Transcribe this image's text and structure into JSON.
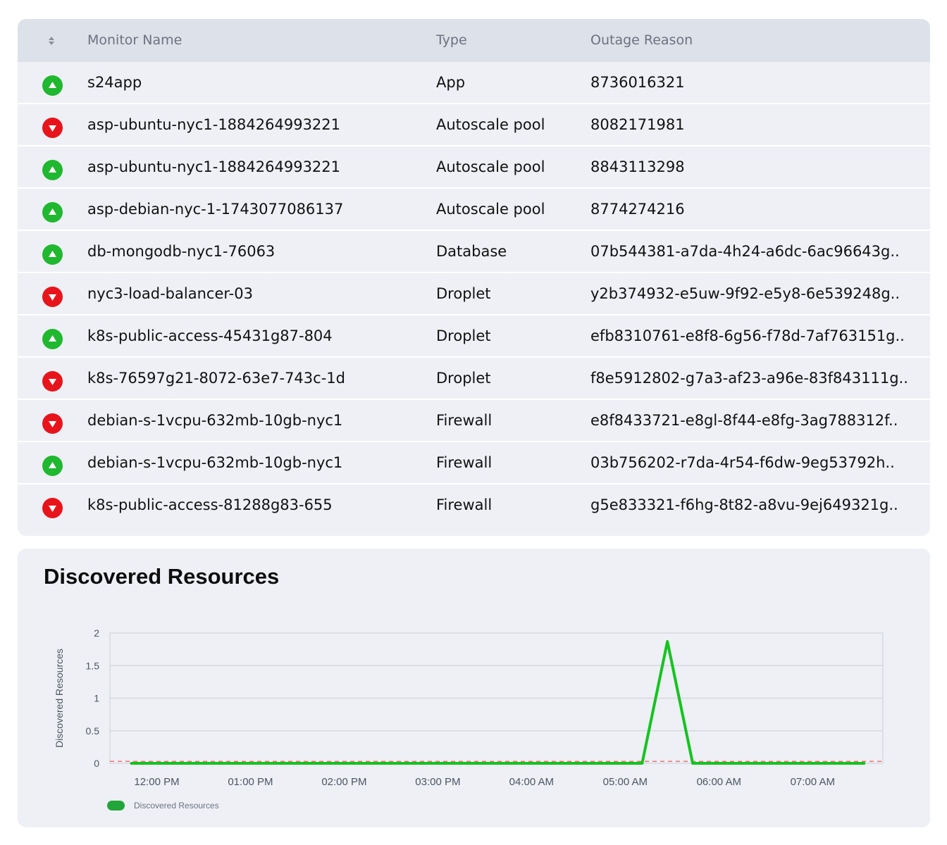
{
  "table": {
    "columns": {
      "name": "Monitor Name",
      "type": "Type",
      "reason": "Outage Reason"
    },
    "rows": [
      {
        "status": "up",
        "name": "s24app",
        "type": "App",
        "reason": "8736016321"
      },
      {
        "status": "down",
        "name": "asp-ubuntu-nyc1-1884264993221",
        "type": "Autoscale pool",
        "reason": "8082171981"
      },
      {
        "status": "up",
        "name": "asp-ubuntu-nyc1-1884264993221",
        "type": "Autoscale pool",
        "reason": "8843113298"
      },
      {
        "status": "up",
        "name": "asp-debian-nyc-1-1743077086137",
        "type": "Autoscale pool",
        "reason": "8774274216"
      },
      {
        "status": "up",
        "name": "db-mongodb-nyc1-76063",
        "type": "Database",
        "reason": "07b544381-a7da-4h24-a6dc-6ac96643g.."
      },
      {
        "status": "down",
        "name": "nyc3-load-balancer-03",
        "type": "Droplet",
        "reason": "y2b374932-e5uw-9f92-e5y8-6e539248g.."
      },
      {
        "status": "up",
        "name": "k8s-public-access-45431g87-804",
        "type": "Droplet",
        "reason": "efb8310761-e8f8-6g56-f78d-7af763151g.."
      },
      {
        "status": "down",
        "name": "k8s-76597g21-8072-63e7-743c-1d",
        "type": "Droplet",
        "reason": "f8e5912802-g7a3-af23-a96e-83f843111g.."
      },
      {
        "status": "down",
        "name": "debian-s-1vcpu-632mb-10gb-nyc1",
        "type": "Firewall",
        "reason": "e8f8433721-e8gl-8f44-e8fg-3ag788312f.."
      },
      {
        "status": "up",
        "name": "debian-s-1vcpu-632mb-10gb-nyc1",
        "type": "Firewall",
        "reason": "03b756202-r7da-4r54-f6dw-9eg53792h.."
      },
      {
        "status": "down",
        "name": "k8s-public-access-81288g83-655",
        "type": "Firewall",
        "reason": "g5e833321-f6hg-8t82-a8vu-9ej649321g.."
      }
    ]
  },
  "colors": {
    "up": "#1fb82f",
    "down": "#e8141b",
    "line": "#14c41f",
    "threshold": "#f07070"
  },
  "chart": {
    "title": "Discovered Resources",
    "legend_label": "Discovered Resources"
  },
  "chart_data": {
    "type": "line",
    "title": "Discovered Resources",
    "ylabel": "Discovered Resources",
    "xlabel": "",
    "ylim": [
      0,
      2
    ],
    "yticks": [
      "0",
      "0.5",
      "1",
      "1.5",
      "2"
    ],
    "xticks": [
      "12:00 PM",
      "01:00 PM",
      "02:00 PM",
      "03:00 PM",
      "04:00 AM",
      "05:00 AM",
      "06:00 AM",
      "07:00 AM"
    ],
    "x_hours": [
      -0.27,
      5.18,
      5.45,
      5.72,
      7.55
    ],
    "series": [
      {
        "name": "Discovered Resources",
        "values": [
          0,
          0,
          1.87,
          0,
          0
        ]
      }
    ],
    "threshold": 0.03,
    "grid": true,
    "legend": "bottom-left"
  }
}
